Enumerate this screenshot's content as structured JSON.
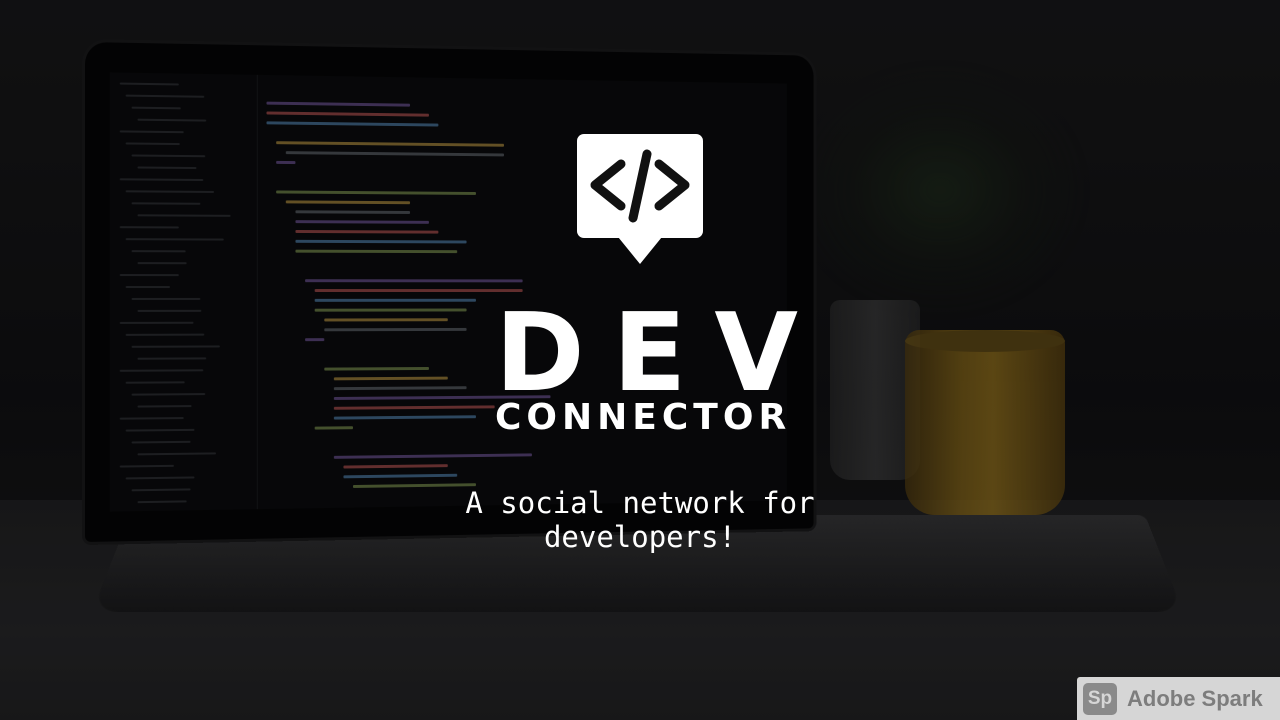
{
  "hero": {
    "logo_icon": "code-brackets-speech-bubble-icon",
    "title_main": "DEV",
    "title_sub": "CONNECTOR",
    "tagline": "A social network for developers!"
  },
  "watermark": {
    "icon_text": "Sp",
    "label": "Adobe Spark"
  },
  "colors": {
    "text": "#ffffff",
    "background": "#0d0d0f",
    "mug_accent": "#b48a22"
  }
}
